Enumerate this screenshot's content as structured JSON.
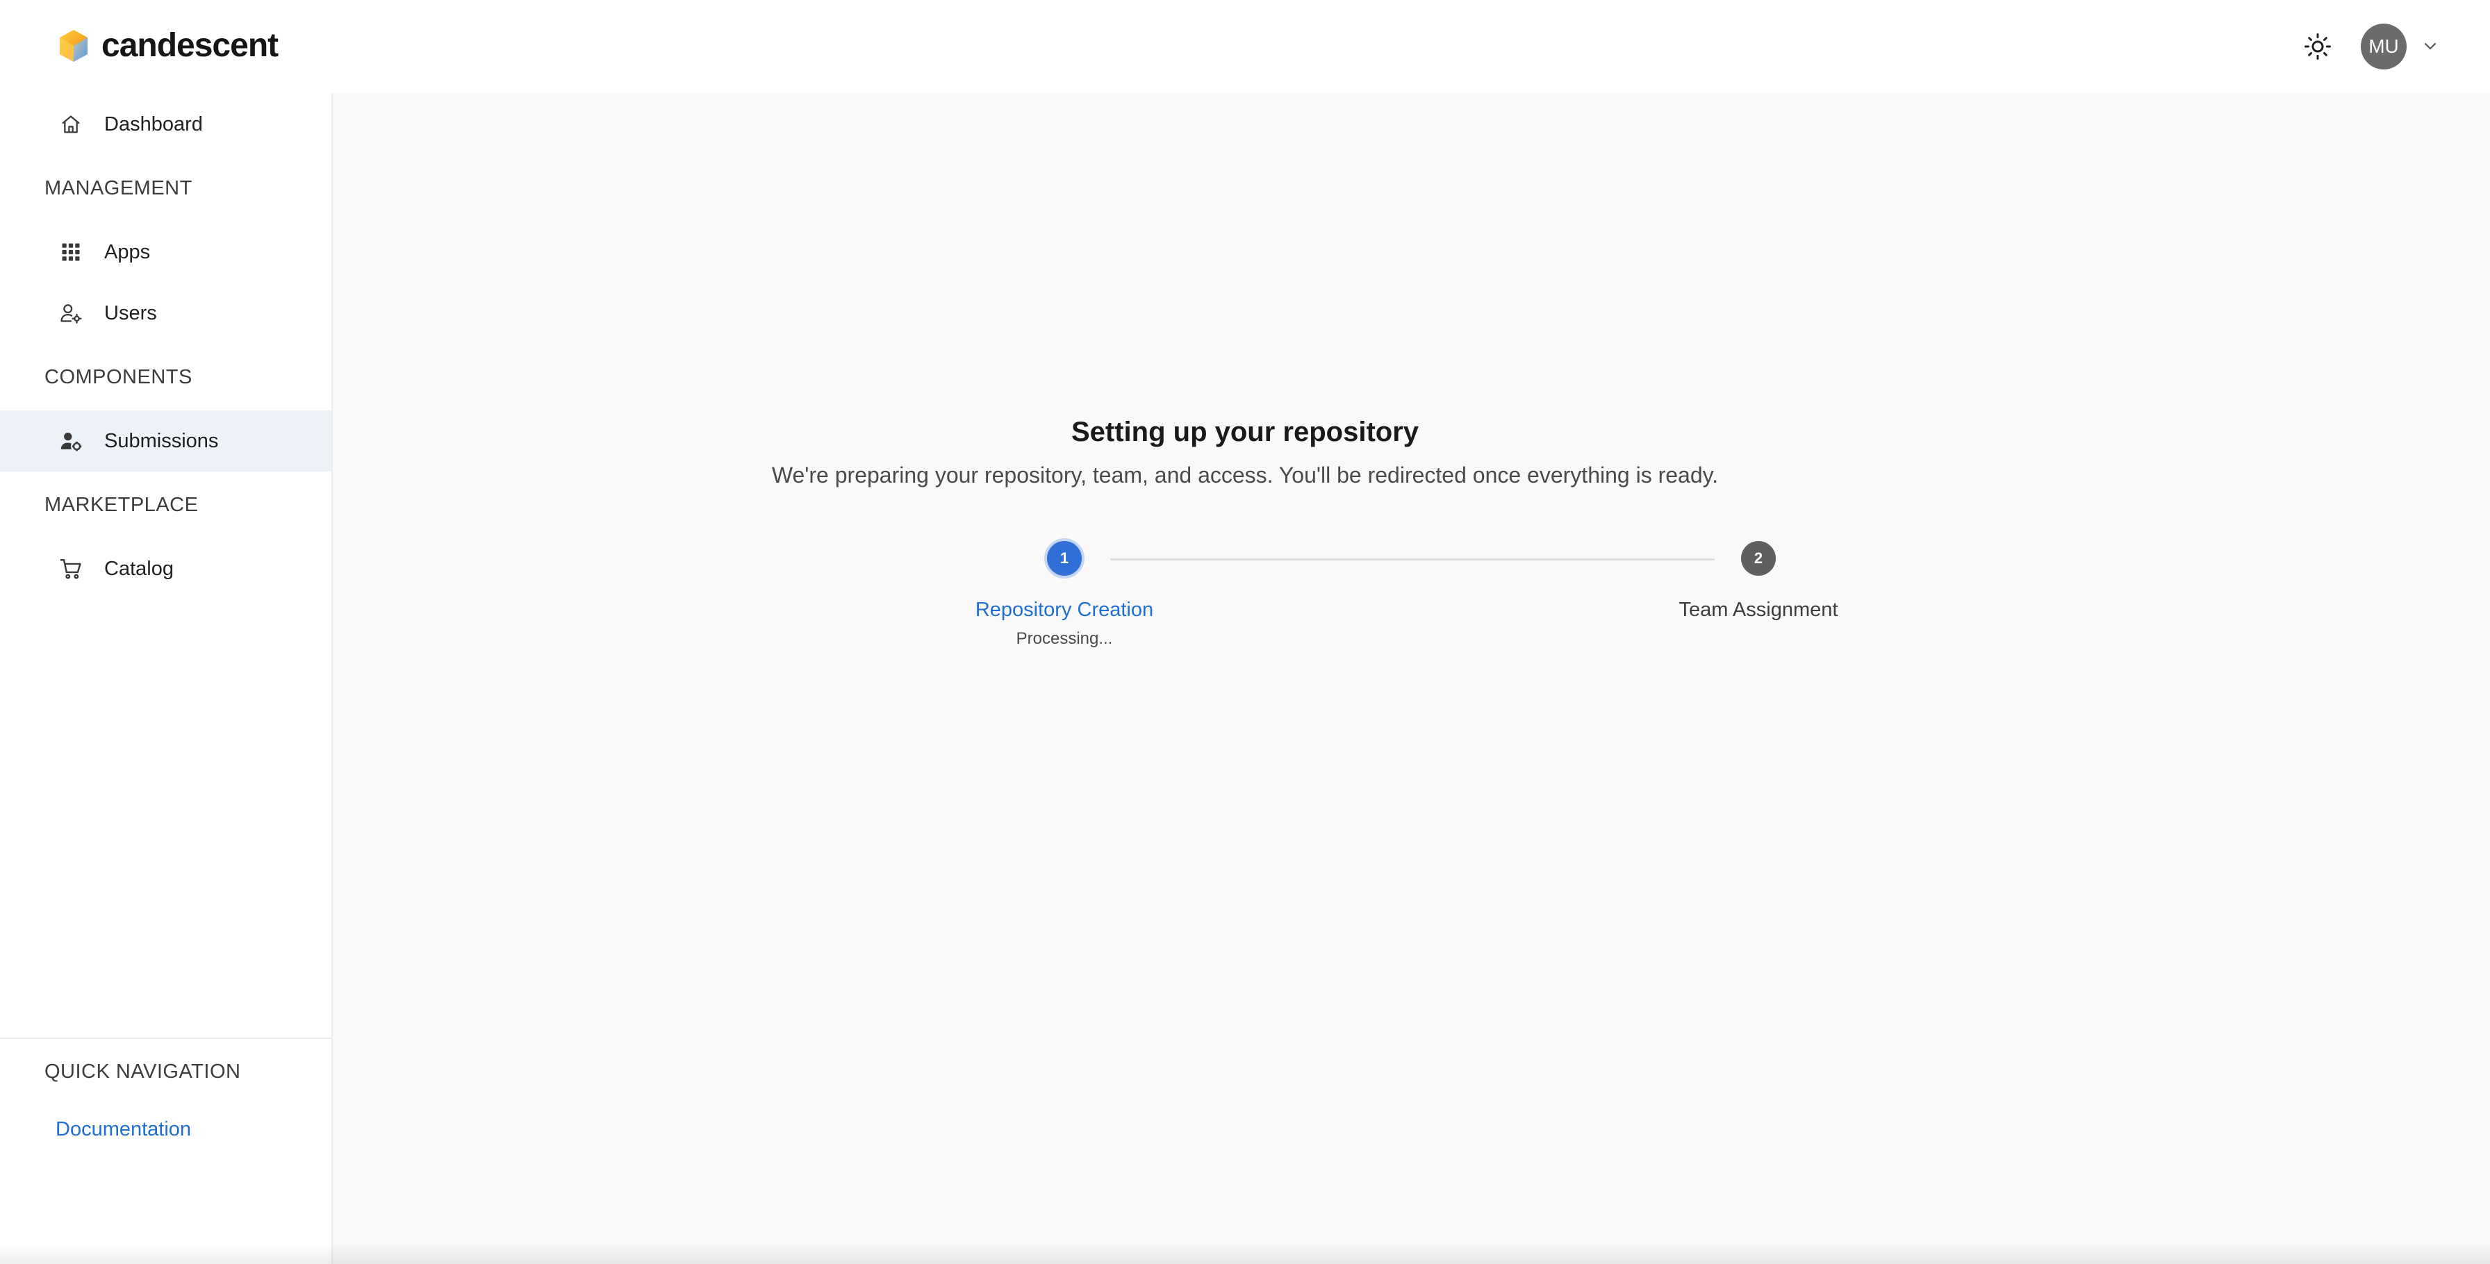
{
  "header": {
    "brand_name": "candescent",
    "avatar_initials": "MU",
    "icons": {
      "logo": "candescent-logo-icon",
      "theme": "sun-icon",
      "account_menu": "chevron-down-icon"
    }
  },
  "sidebar": {
    "dashboard": {
      "label": "Dashboard",
      "icon": "home-icon"
    },
    "sections": {
      "management": "MANAGEMENT",
      "components": "COMPONENTS",
      "marketplace": "MARKETPLACE",
      "quick_navigation": "QUICK NAVIGATION"
    },
    "items": {
      "apps": {
        "label": "Apps",
        "icon": "grid-icon"
      },
      "users": {
        "label": "Users",
        "icon": "user-settings-icon"
      },
      "submissions": {
        "label": "Submissions",
        "icon": "user-gear-icon",
        "active": true
      },
      "catalog": {
        "label": "Catalog",
        "icon": "cart-icon"
      }
    },
    "documentation_link": "Documentation"
  },
  "main": {
    "title": "Setting up your repository",
    "subtitle": "We're preparing your repository, team, and access. You'll be redirected once everything is ready.",
    "steps": [
      {
        "number": "1",
        "label": "Repository Creation",
        "status": "Processing...",
        "state": "active"
      },
      {
        "number": "2",
        "label": "Team Assignment",
        "state": "pending"
      }
    ]
  },
  "colors": {
    "accent": "#2f6fd6",
    "link": "#1f6fd1",
    "active_nav_bg": "#edf1f8",
    "pending_step": "#5f5f5f",
    "main_bg": "#f9f9f9"
  }
}
